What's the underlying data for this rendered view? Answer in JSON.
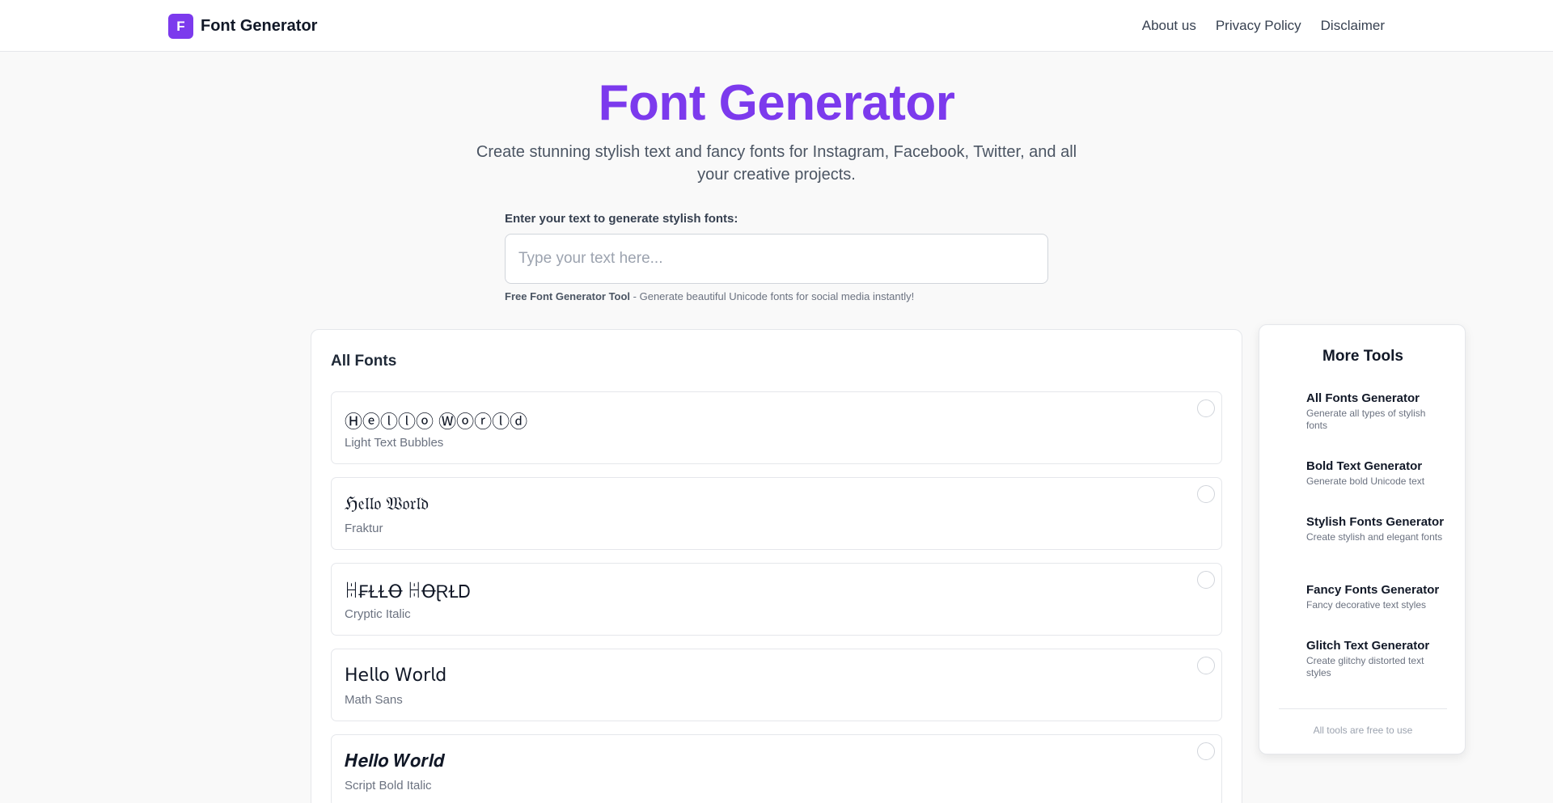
{
  "header": {
    "logo_letter": "F",
    "brand": "Font Generator",
    "nav": [
      "About us",
      "Privacy Policy",
      "Disclaimer"
    ]
  },
  "hero": {
    "title": "Font Generator",
    "subtitle": "Create stunning stylish text and fancy fonts for Instagram, Facebook, Twitter, and all your creative projects."
  },
  "input": {
    "label": "Enter your text to generate stylish fonts:",
    "placeholder": "Type your text here...",
    "value": ""
  },
  "hint": {
    "icon": "",
    "bold": "Free Font Generator Tool",
    "text": " - Generate beautiful Unicode fonts for social media instantly!"
  },
  "fonts_panel": {
    "heading": "All Fonts",
    "copy_icon": "",
    "items": [
      {
        "sample": "Ⓗⓔⓛⓛⓞ Ⓦⓞⓡⓛⓓ",
        "name": "Light Text Bubbles"
      },
      {
        "sample": "ℌ𝔢𝔩𝔩𝔬 𝔚𝔬𝔯𝔩𝔡",
        "name": "Fraktur"
      },
      {
        "sample": "ꀍ₣ⱢⱢꝊ ꀍꝊⱤⱢᎠ",
        "name": "Cryptic Italic"
      },
      {
        "sample": "𝖧𝖾𝗅𝗅𝗈 𝖶𝗈𝗋𝗅𝖽",
        "name": "Math Sans"
      },
      {
        "sample": "𝑯𝒆𝒍𝒍𝒐 𝑾𝒐𝒓𝒍𝒅",
        "name": "Script Bold Italic"
      }
    ]
  },
  "sidebar": {
    "title": "More Tools",
    "tool_icon": "",
    "tools": [
      {
        "name": "All Fonts Generator",
        "desc": "Generate all types of stylish fonts"
      },
      {
        "name": "Bold Text Generator",
        "desc": "Generate bold Unicode text"
      },
      {
        "name": "Stylish Fonts Generator",
        "desc": "Create stylish and elegant fonts"
      },
      {
        "name": "Fancy Fonts Generator",
        "desc": "Fancy decorative text styles"
      },
      {
        "name": "Glitch Text Generator",
        "desc": "Create glitchy distorted text styles"
      }
    ],
    "footer": " All tools are free to use"
  }
}
